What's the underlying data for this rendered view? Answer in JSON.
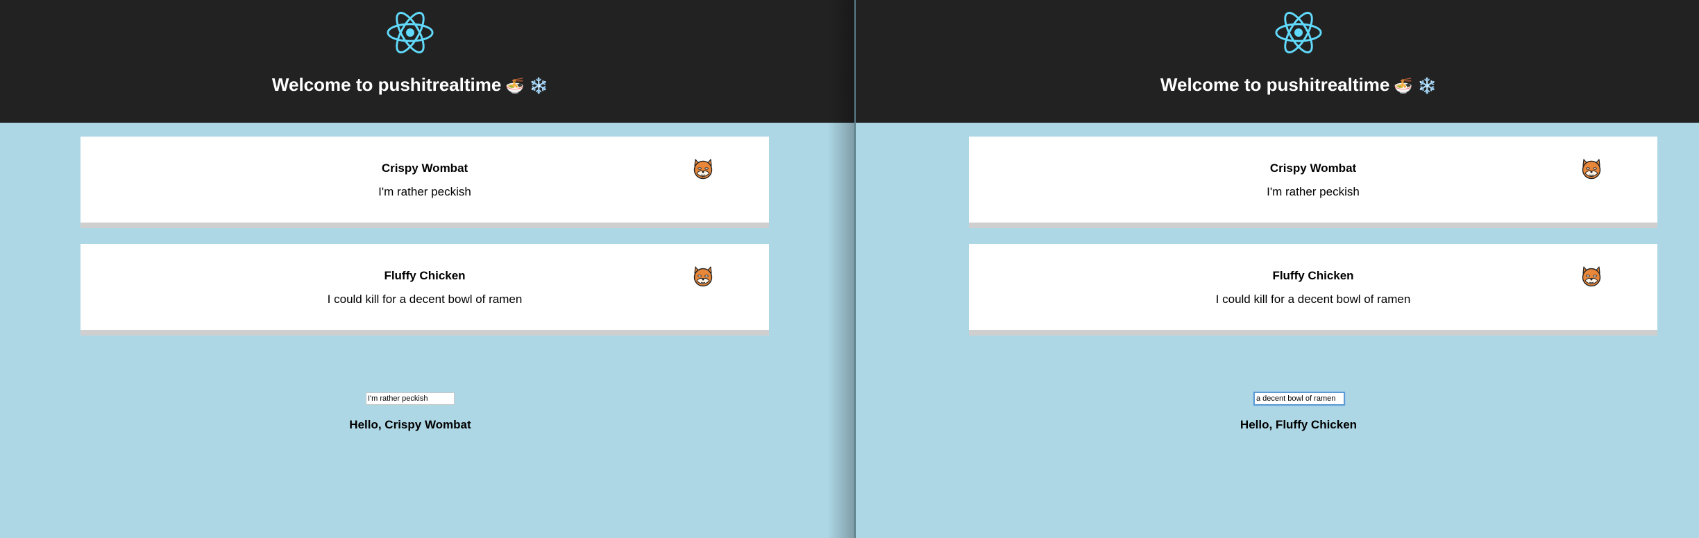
{
  "colors": {
    "header_bg": "#222222",
    "page_bg": "#aed7e5",
    "react_blue": "#61dafb",
    "card_bg": "#ffffff",
    "card_border": "#cfcfcf"
  },
  "windows": [
    {
      "header": {
        "logo_icon": "react-logo-icon",
        "title": "Welcome to pushitrealtime",
        "title_emoji": "🍜 ❄️"
      },
      "messages": [
        {
          "author": "Crispy Wombat",
          "text": "I'm rather peckish",
          "avatar_icon": "shiba-dog-avatar-icon"
        },
        {
          "author": "Fluffy Chicken",
          "text": "I could kill for a decent bowl of ramen",
          "avatar_icon": "shiba-dog-avatar-icon"
        }
      ],
      "input": {
        "value": "I'm rather peckish",
        "focused": false
      },
      "greeting": "Hello, Crispy Wombat"
    },
    {
      "header": {
        "logo_icon": "react-logo-icon",
        "title": "Welcome to pushitrealtime",
        "title_emoji": "🍜 ❄️"
      },
      "messages": [
        {
          "author": "Crispy Wombat",
          "text": "I'm rather peckish",
          "avatar_icon": "shiba-dog-avatar-icon"
        },
        {
          "author": "Fluffy Chicken",
          "text": "I could kill for a decent bowl of ramen",
          "avatar_icon": "shiba-dog-avatar-icon"
        }
      ],
      "input": {
        "value": "a decent bowl of ramen",
        "focused": true
      },
      "greeting": "Hello, Fluffy Chicken"
    }
  ]
}
